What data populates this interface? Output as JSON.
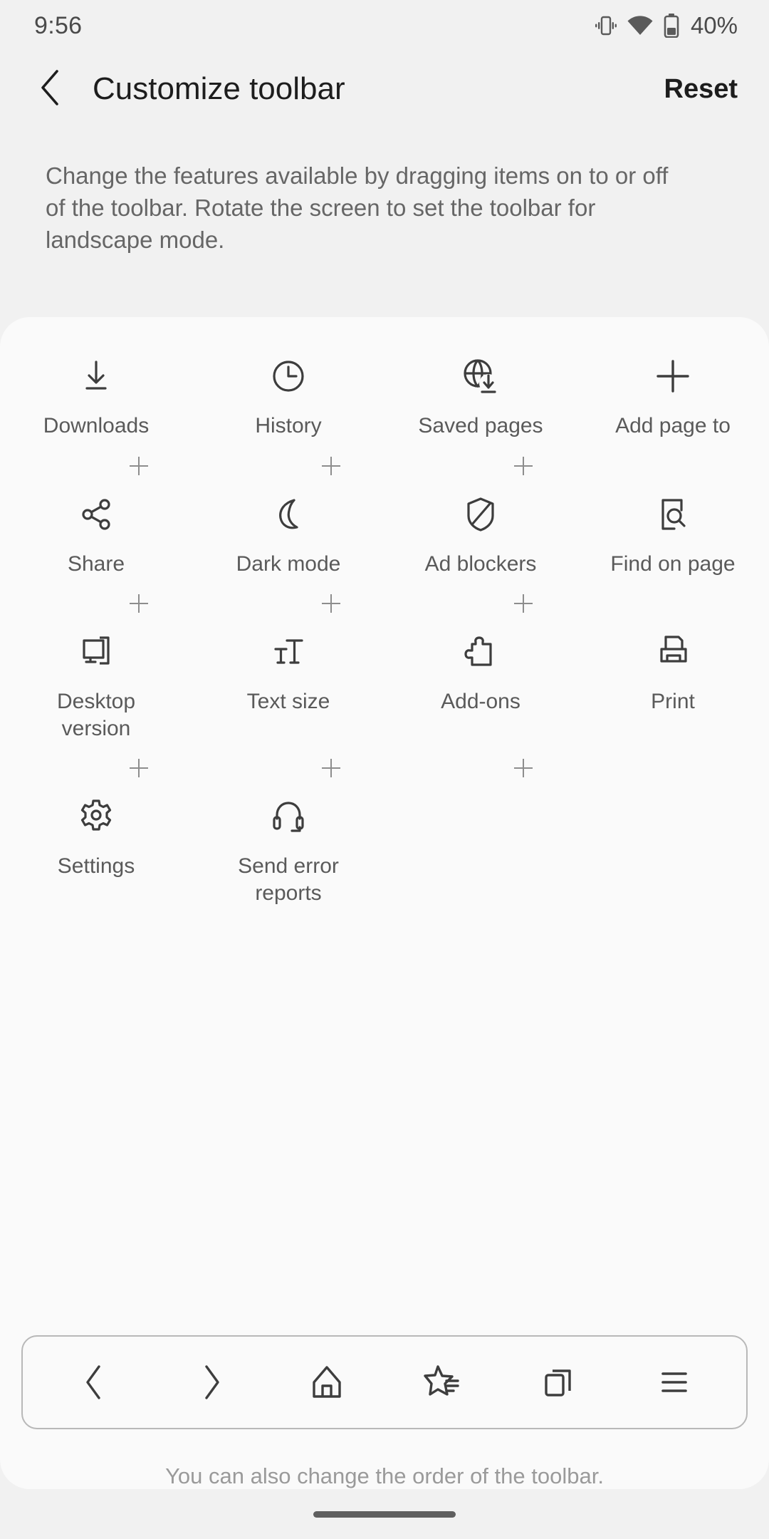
{
  "status_bar": {
    "time": "9:56",
    "battery_percent": "40%",
    "icons": [
      "vibrate-icon",
      "wifi-icon",
      "battery-icon"
    ]
  },
  "app_bar": {
    "back_icon": "chevron-left-icon",
    "title": "Customize toolbar",
    "reset_label": "Reset"
  },
  "description": "Change the features available by dragging items on to or off of the toolbar. Rotate the screen to set the toolbar for landscape mode.",
  "grid": {
    "rows": [
      [
        {
          "label": "Downloads",
          "icon": "download-icon"
        },
        {
          "label": "History",
          "icon": "clock-icon"
        },
        {
          "label": "Saved pages",
          "icon": "globe-download-icon"
        },
        {
          "label": "Add page to",
          "icon": "plus-icon"
        }
      ],
      [
        {
          "label": "Share",
          "icon": "share-icon"
        },
        {
          "label": "Dark mode",
          "icon": "moon-icon"
        },
        {
          "label": "Ad blockers",
          "icon": "shield-icon"
        },
        {
          "label": "Find on page",
          "icon": "page-search-icon"
        }
      ],
      [
        {
          "label": "Desktop version",
          "icon": "desktop-icon"
        },
        {
          "label": "Text size",
          "icon": "text-size-icon"
        },
        {
          "label": "Add-ons",
          "icon": "puzzle-icon"
        },
        {
          "label": "Print",
          "icon": "printer-icon"
        }
      ],
      [
        {
          "label": "Settings",
          "icon": "gear-icon"
        },
        {
          "label": "Send error reports",
          "icon": "headset-icon"
        }
      ]
    ]
  },
  "toolbar_preview": {
    "items": [
      {
        "name": "back",
        "icon": "chevron-left-icon"
      },
      {
        "name": "forward",
        "icon": "chevron-right-icon"
      },
      {
        "name": "home",
        "icon": "home-icon"
      },
      {
        "name": "bookmarks",
        "icon": "bookmark-star-icon"
      },
      {
        "name": "tabs",
        "icon": "tabs-icon"
      },
      {
        "name": "menu",
        "icon": "hamburger-menu-icon"
      }
    ]
  },
  "footer_note": "You can also change the order of the toolbar.",
  "colors": {
    "page_background": "#f1f1f1",
    "card_background": "#fafafa",
    "icon_stroke": "#3d3d3d",
    "label_text": "#5a5a5a",
    "muted_text": "#9a9a9a",
    "title_text": "#1d1d1d"
  }
}
